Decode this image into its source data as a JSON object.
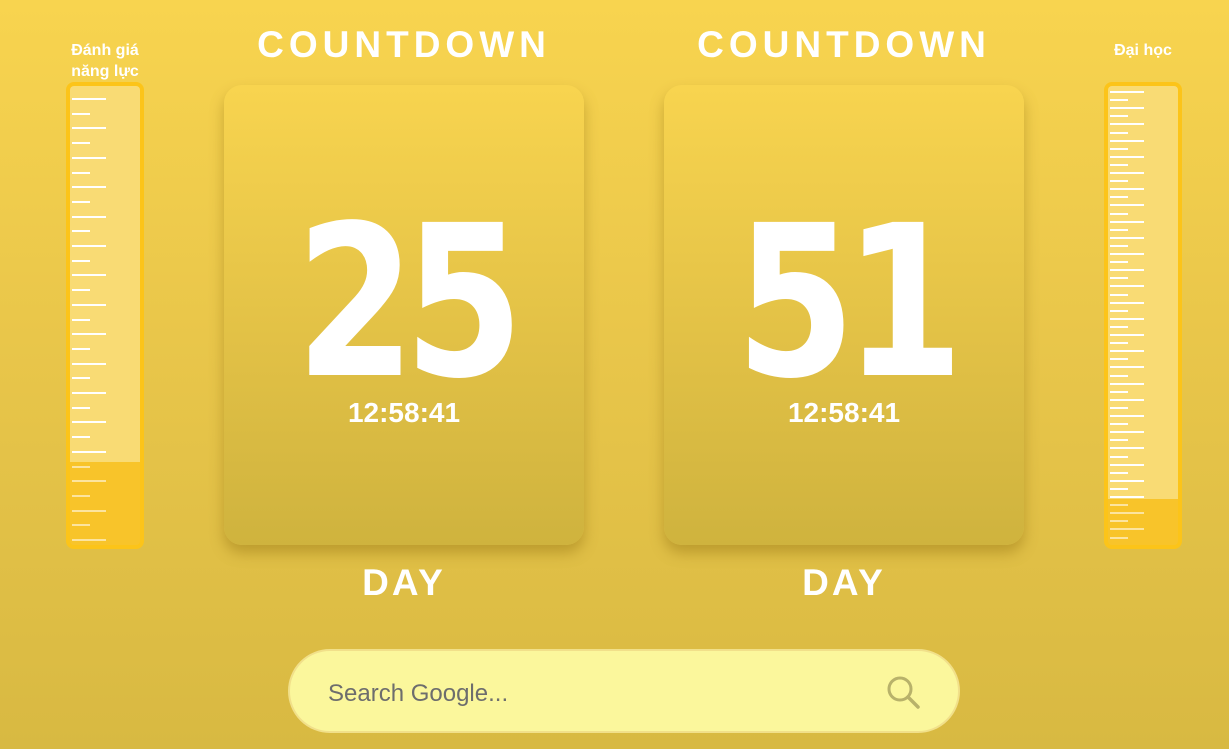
{
  "left_gauge": {
    "label_line1": "Đánh giá",
    "label_line2": "năng lực",
    "fill_fraction": 0.18
  },
  "right_gauge": {
    "label": "Đại học",
    "fill_fraction": 0.1
  },
  "countdowns": [
    {
      "title": "COUNTDOWN",
      "days": "25",
      "time": "12:58:41",
      "unit": "DAY"
    },
    {
      "title": "COUNTDOWN",
      "days": "51",
      "time": "12:58:41",
      "unit": "DAY"
    }
  ],
  "search": {
    "placeholder": "Search Google...",
    "icon": "search-icon"
  },
  "colors": {
    "accent": "#fcc419",
    "search_bg": "#fbf79c",
    "text": "#ffffff"
  }
}
